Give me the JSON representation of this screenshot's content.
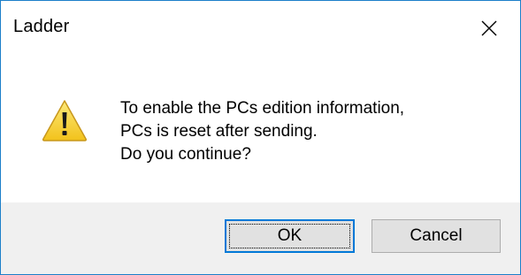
{
  "window": {
    "title": "Ladder",
    "close_icon": "close-x-icon",
    "border_color": "#1c7fc9"
  },
  "message": {
    "icon": "warning-triangle-icon",
    "lines": [
      "To enable the PCs edition information,",
      "PCs is reset after sending.",
      "Do you continue?"
    ]
  },
  "buttons": {
    "ok_label": "OK",
    "cancel_label": "Cancel",
    "focus_color": "#0078d7"
  }
}
